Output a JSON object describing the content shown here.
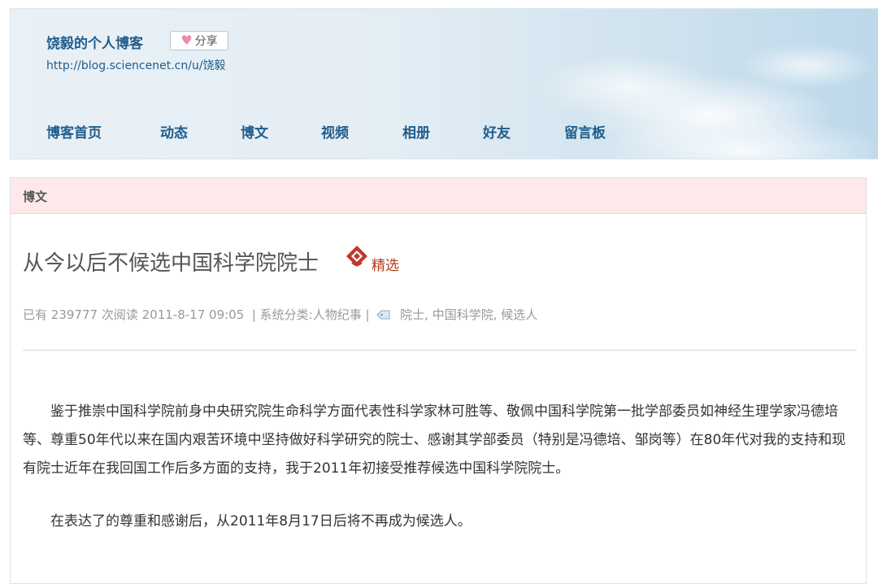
{
  "header": {
    "blog_name": "饶毅的个人博客",
    "share_label": "分享",
    "blog_url": "http://blog.sciencenet.cn/u/饶毅"
  },
  "nav": {
    "items": [
      {
        "label": "博客首页"
      },
      {
        "label": "动态"
      },
      {
        "label": "博文"
      },
      {
        "label": "视频"
      },
      {
        "label": "相册"
      },
      {
        "label": "好友"
      },
      {
        "label": "留言板"
      }
    ]
  },
  "section": {
    "title": "博文"
  },
  "post": {
    "title": "从今以后不候选中国科学院院士",
    "badge": "精选",
    "meta": {
      "reads_prefix": "已有",
      "reads_count": "239777",
      "reads_suffix": "次阅读",
      "datetime": "2011-8-17 09:05",
      "separator": "|",
      "category_label": "系统分类:人物纪事",
      "tags": [
        "院士",
        "中国科学院",
        "候选人"
      ]
    },
    "paragraphs": [
      "鉴于推崇中国科学院前身中央研究院生命科学方面代表性科学家林可胜等、敬佩中国科学院第一批学部委员如神经生理学家冯德培等、尊重50年代以来在国内艰苦环境中坚持做好科学研究的院士、感谢其学部委员（特别是冯德培、邹岗等）在80年代对我的支持和现有院士近年在我回国工作后多方面的支持，我于2011年初接受推荐候选中国科学院院士。",
      "在表达了的尊重和感谢后，从2011年8月17日后将不再成为候选人。"
    ]
  },
  "colors": {
    "nav_text": "#1f5d8c",
    "section_bar": "#fde9ea",
    "badge_text": "#b33a1a"
  }
}
